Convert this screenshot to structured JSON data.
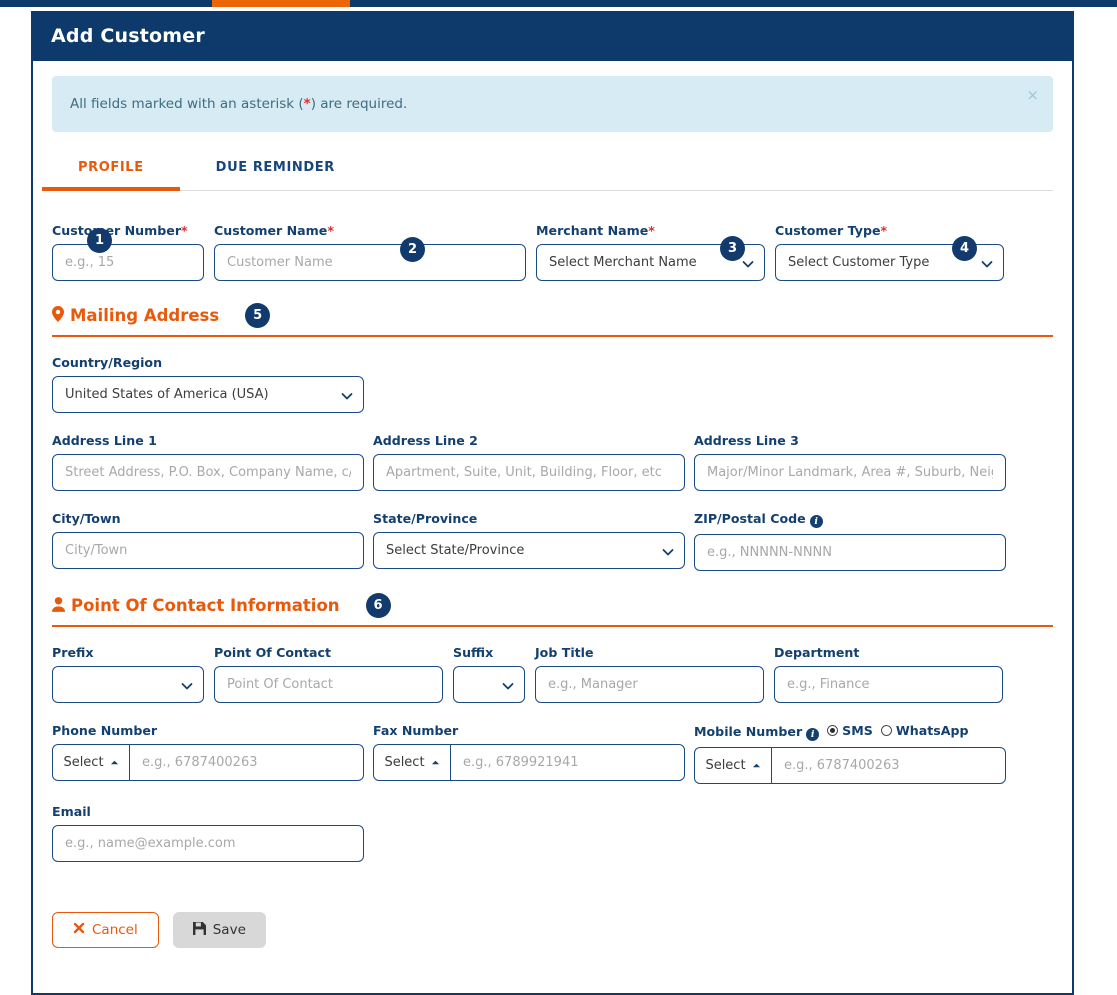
{
  "topbar": {
    "accent_color": "#ec6608",
    "bar_color": "#0d3a6b"
  },
  "modal": {
    "title": "Add Customer",
    "header_bg": "#0d3a6b"
  },
  "alert": {
    "prefix": "All fields marked with an asterisk (",
    "star": "*",
    "suffix": ") are required.",
    "close_label": "×"
  },
  "tabs": [
    {
      "label": "PROFILE",
      "active": true
    },
    {
      "label": "DUE REMINDER",
      "active": false
    }
  ],
  "badges": [
    "1",
    "2",
    "3",
    "4",
    "5",
    "6"
  ],
  "profile": {
    "customer_number": {
      "label": "Customer Number",
      "required": "*",
      "placeholder": "e.g., 15",
      "value": ""
    },
    "customer_name": {
      "label": "Customer Name",
      "required": "*",
      "placeholder": "Customer Name",
      "value": ""
    },
    "merchant_name": {
      "label": "Merchant Name",
      "required": "*",
      "selected": "Select Merchant Name"
    },
    "customer_type": {
      "label": "Customer Type",
      "required": "*",
      "selected": "Select Customer Type"
    }
  },
  "mailing_address": {
    "section_title": "Mailing Address",
    "section_icon": "map-pin-icon",
    "country": {
      "label": "Country/Region",
      "selected": "United States of America (USA)"
    },
    "address1": {
      "label": "Address Line 1",
      "placeholder": "Street Address, P.O. Box, Company Name, c/o",
      "value": ""
    },
    "address2": {
      "label": "Address Line 2",
      "placeholder": "Apartment, Suite, Unit, Building, Floor, etc",
      "value": ""
    },
    "address3": {
      "label": "Address Line 3",
      "placeholder": "Major/Minor Landmark, Area #, Suburb, Neighborhood",
      "value": ""
    },
    "city": {
      "label": "City/Town",
      "placeholder": "City/Town",
      "value": ""
    },
    "state": {
      "label": "State/Province",
      "selected": "Select State/Province"
    },
    "zip": {
      "label": "ZIP/Postal Code",
      "placeholder": "e.g., NNNNN-NNNN",
      "value": "",
      "info": "i"
    }
  },
  "point_of_contact": {
    "section_title": "Point Of Contact Information",
    "section_icon": "person-icon",
    "prefix": {
      "label": "Prefix",
      "selected": ""
    },
    "contact": {
      "label": "Point Of Contact",
      "placeholder": "Point Of Contact",
      "value": ""
    },
    "suffix": {
      "label": "Suffix",
      "selected": ""
    },
    "job_title": {
      "label": "Job Title",
      "placeholder": "e.g., Manager",
      "value": ""
    },
    "department": {
      "label": "Department",
      "placeholder": "e.g., Finance",
      "value": ""
    },
    "phone": {
      "label": "Phone Number",
      "prefix_label": "Select",
      "placeholder": "e.g., 6787400263",
      "value": ""
    },
    "fax": {
      "label": "Fax Number",
      "prefix_label": "Select",
      "placeholder": "e.g., 6789921941",
      "value": ""
    },
    "mobile": {
      "label": "Mobile Number",
      "info": "i",
      "prefix_label": "Select",
      "placeholder": "e.g., 6787400263",
      "value": "",
      "radios": [
        {
          "label": "SMS",
          "checked": true
        },
        {
          "label": "WhatsApp",
          "checked": false
        }
      ]
    },
    "email": {
      "label": "Email",
      "placeholder": "e.g., name@example.com",
      "value": ""
    }
  },
  "footer": {
    "cancel_label": "Cancel",
    "cancel_icon": "close-x-icon",
    "save_label": "Save",
    "save_icon": "floppy-disk-icon"
  }
}
